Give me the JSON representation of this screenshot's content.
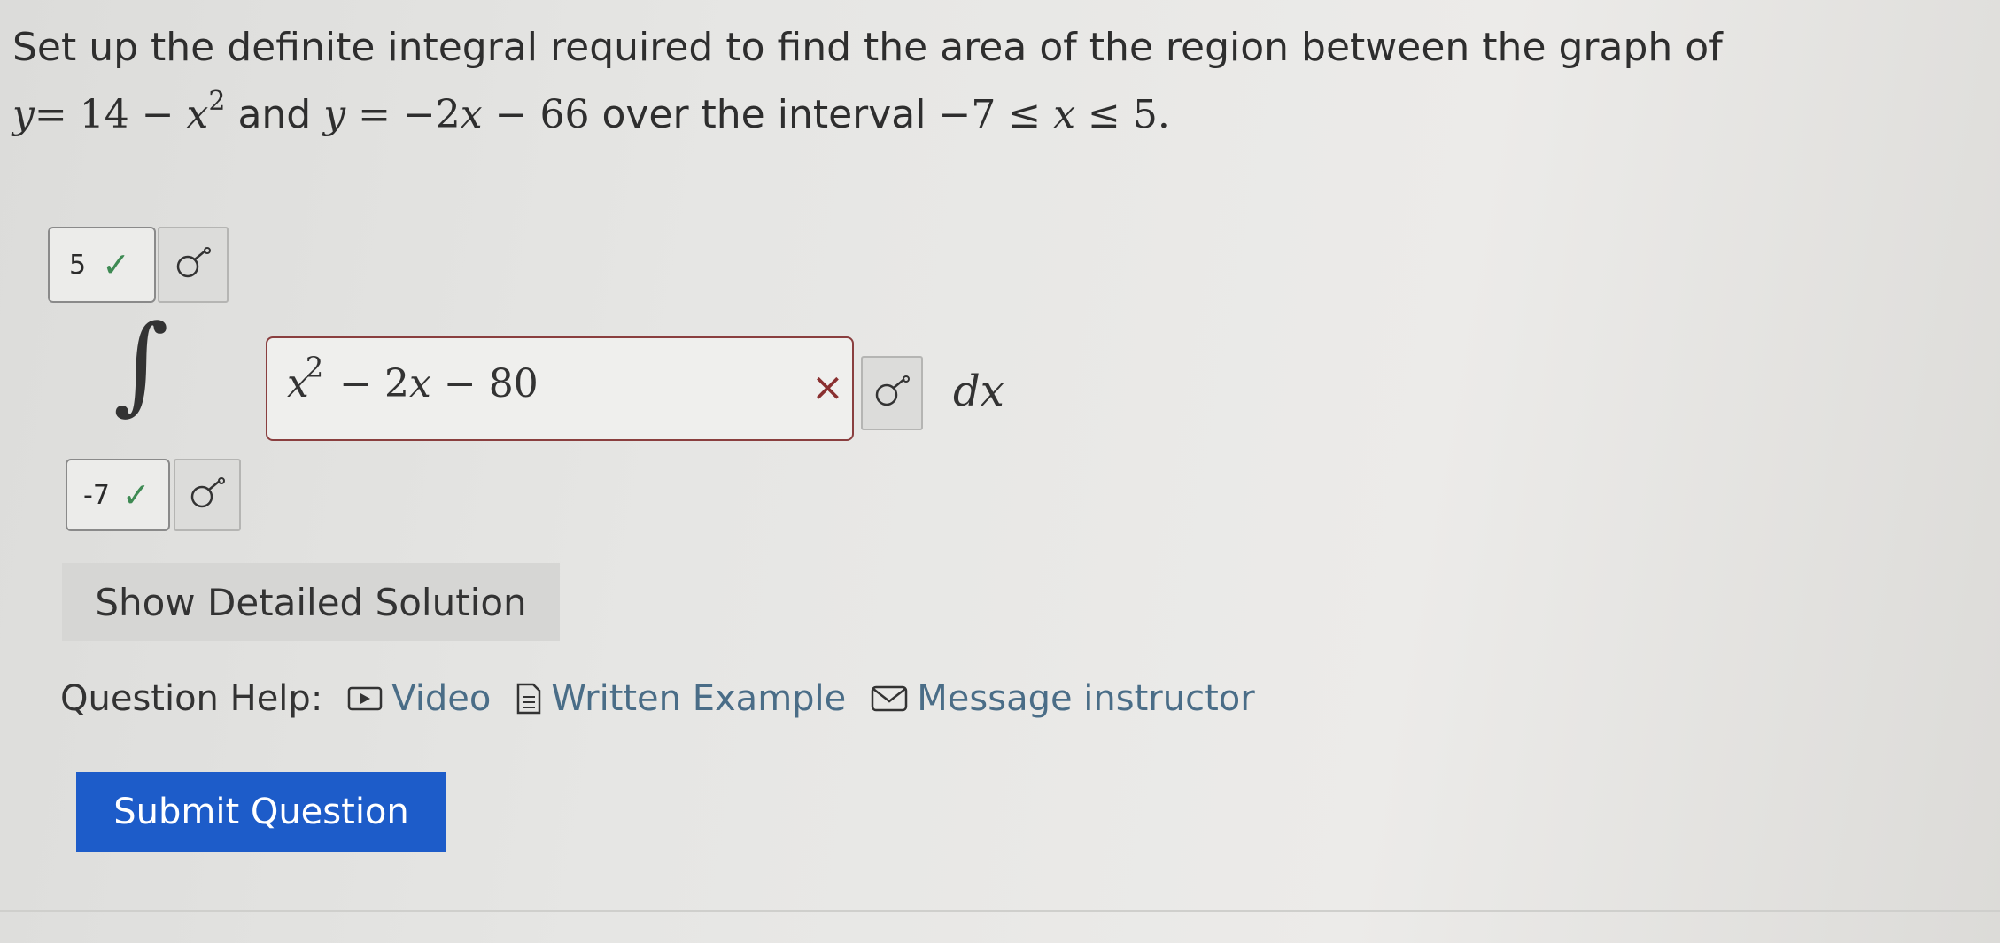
{
  "question": {
    "line1": "Set up the definite integral required to find the area of the region between the graph of",
    "line2": {
      "eq1_lhs": "y",
      "eq1_rhs": "= 14 − ",
      "eq1_var": "x",
      "eq1_exp": "2",
      "and": " and ",
      "eq2_lhs": "y",
      "eq2_rhs_a": " = −2",
      "eq2_var": "x",
      "eq2_rhs_b": " − 66",
      "over": " over the interval ",
      "interval_a": "−7 ≤ ",
      "interval_var": "x",
      "interval_b": " ≤ 5."
    }
  },
  "answer": {
    "upper_limit": "5",
    "lower_limit": "-7",
    "integral_sign": "∫",
    "integrand": {
      "var": "x",
      "exp": "2",
      "rest_a": " − 2",
      "rest_var": "x",
      "rest_b": " − 80"
    },
    "differential": "dx",
    "upper_status": "✓",
    "lower_status": "✓",
    "integrand_status": "×"
  },
  "buttons": {
    "show_solution": "Show Detailed Solution",
    "submit": "Submit Question"
  },
  "help": {
    "label": "Question Help:",
    "video": "Video",
    "written_example": "Written Example",
    "message_instructor": "Message instructor"
  },
  "colors": {
    "correct": "#3e8a53",
    "incorrect": "#8a3030",
    "link": "#4a6d87",
    "submit_bg": "#1d5cc9"
  }
}
